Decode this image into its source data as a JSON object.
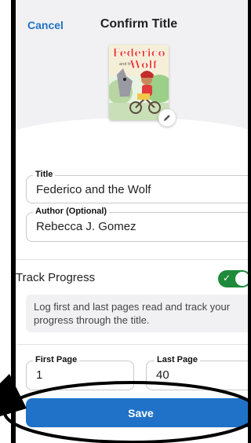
{
  "header": {
    "cancel_label": "Cancel",
    "title": "Confirm Title"
  },
  "cover": {
    "title_line1": "Federico",
    "title_line2": "and the",
    "title_line3": "Wolf",
    "edit_icon": "pencil-icon"
  },
  "form": {
    "title_label": "Title",
    "title_value": "Federico and the Wolf",
    "author_label": "Author (Optional)",
    "author_value": "Rebecca J. Gomez",
    "track_progress_label": "Track Progress",
    "track_progress_on": true,
    "track_info": "Log first and last pages read and track your progress through the title.",
    "first_page_label": "First Page",
    "first_page_value": "1",
    "last_page_label": "Last Page",
    "last_page_value": "40"
  },
  "actions": {
    "save_label": "Save"
  },
  "colors": {
    "accent": "#2072c8",
    "toggle_on": "#1e8a3b",
    "annotation": "#000000"
  }
}
